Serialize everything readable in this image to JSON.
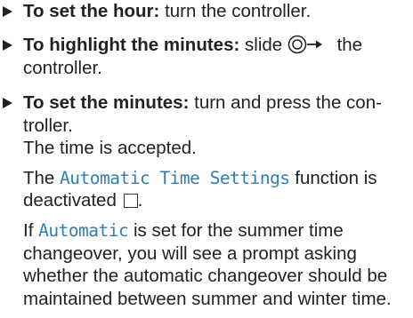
{
  "steps": [
    {
      "label": "To set the hour:",
      "text": " turn the controller."
    },
    {
      "label": "To highlight the minutes:",
      "text_before": " slide ",
      "icon": "controller-slide-right-icon",
      "text_after": " the controller."
    },
    {
      "label": "To set the minutes:",
      "text": " turn and press the con-troller.",
      "result": "The time is accepted.",
      "note1_before": "The ",
      "note1_code": "Automatic Time Settings",
      "note1_after": " function is deactivated ",
      "note1_icon": "unchecked-checkbox-icon",
      "note1_end": ".",
      "note2_before": "If ",
      "note2_code": "Automatic",
      "note2_after": " is set for the summer time changeover, you will see a prompt asking whether the automatic changeover should be maintained between summer and winter time."
    }
  ]
}
